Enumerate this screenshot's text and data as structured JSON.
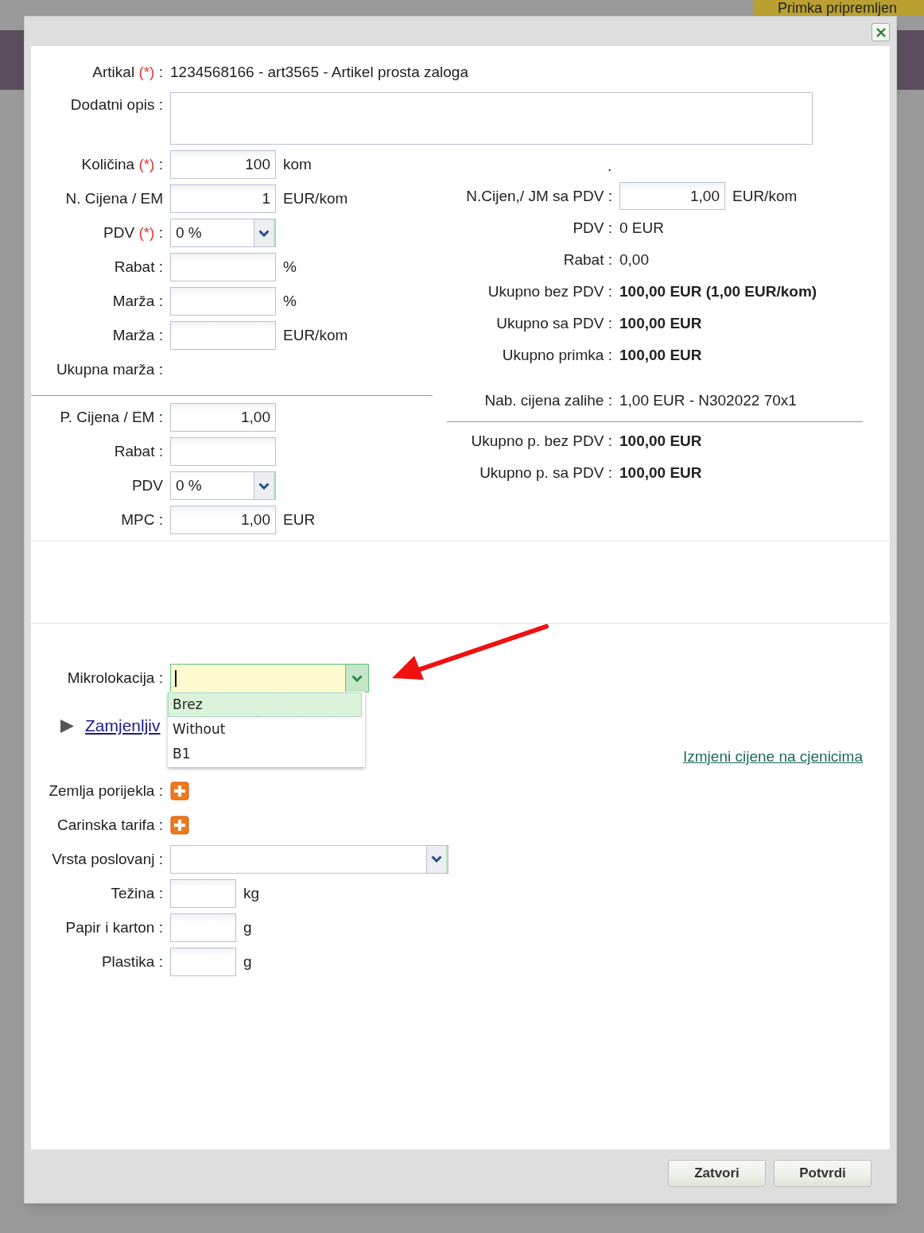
{
  "background_badge": "Primka pripremljen",
  "article": {
    "label": "Artikal",
    "required_mark": "(*)",
    "colon": ":",
    "value": "1234568166 - art3565 - Artikel prosta zaloga"
  },
  "description": {
    "label": "Dodatni opis :"
  },
  "purchase_fields": [
    {
      "kind": "input",
      "label": "Količina",
      "required_mark": "(*)",
      "colon": ":",
      "value": "100",
      "unit": "kom"
    },
    {
      "kind": "input",
      "label": "N. Cijena / EM",
      "value": "1",
      "unit": "EUR/kom"
    },
    {
      "kind": "select",
      "label": "PDV",
      "required_mark": "(*)",
      "colon": ":",
      "value": "0 %"
    },
    {
      "kind": "input",
      "label": "Rabat :",
      "unit": "%"
    },
    {
      "kind": "input",
      "label": "Marža :",
      "unit": "%"
    },
    {
      "kind": "input",
      "label": "Marža :",
      "unit": "EUR/kom"
    },
    {
      "kind": "text",
      "label": "Ukupna marža :"
    }
  ],
  "sale_fields": [
    {
      "kind": "input",
      "label": "P. Cijena / EM :",
      "value": "1,00"
    },
    {
      "kind": "input",
      "label": "Rabat :"
    },
    {
      "kind": "select",
      "label": "PDV",
      "value": "0 %"
    },
    {
      "kind": "input",
      "label": "MPC :",
      "value": "1,00",
      "unit": "EUR"
    }
  ],
  "summary": {
    "note": ".",
    "lines": [
      {
        "kind": "input",
        "label": "N.Cijen,/ JM sa PDV :",
        "value": "1,00",
        "unit": "EUR/kom"
      },
      {
        "kind": "text",
        "label": "PDV :",
        "value": "0 EUR",
        "bold": false
      },
      {
        "kind": "text",
        "label": "Rabat :",
        "value": "0,00",
        "bold": false
      },
      {
        "kind": "text",
        "label": "Ukupno bez PDV :",
        "value": "100,00 EUR (1,00 EUR/kom)",
        "bold": true
      },
      {
        "kind": "text",
        "label": "Ukupno sa PDV :",
        "value": "100,00 EUR",
        "bold": true
      },
      {
        "kind": "text",
        "label": "Ukupno primka :",
        "value": "100,00 EUR",
        "bold": true
      }
    ],
    "stock_price": {
      "label": "Nab. cijena zalihe :",
      "value": "1,00 EUR - N302022 70x1",
      "bold": false
    },
    "totals": [
      {
        "label": "Ukupno p. bez PDV :",
        "value": "100,00 EUR",
        "bold": true
      },
      {
        "label": "Ukupno p. sa PDV :",
        "value": "100,00 EUR",
        "bold": true
      }
    ]
  },
  "microlocation": {
    "label": "Mikrolokacija :",
    "focused": true,
    "options": [
      {
        "label": "Brez",
        "selected": true
      },
      {
        "label": "Without",
        "selected": false
      },
      {
        "label": "B1",
        "selected": false
      }
    ]
  },
  "replaceable": {
    "label": "Zamjenljiv",
    "expanded": false
  },
  "price_list_link": "Izmjeni cijene na cjenicima",
  "extra_fields": [
    {
      "kind": "add",
      "label": "Zemlja porijekla :"
    },
    {
      "kind": "add",
      "label": "Carinska tarifa :"
    },
    {
      "kind": "select",
      "label": "Vrsta poslovanj :"
    },
    {
      "kind": "input",
      "label": "Težina :",
      "unit": "kg"
    },
    {
      "kind": "input",
      "label": "Papir i karton :",
      "unit": "g"
    },
    {
      "kind": "input",
      "label": "Plastika :",
      "unit": "g"
    }
  ],
  "buttons": [
    "Zatvori",
    "Potvrdi"
  ]
}
